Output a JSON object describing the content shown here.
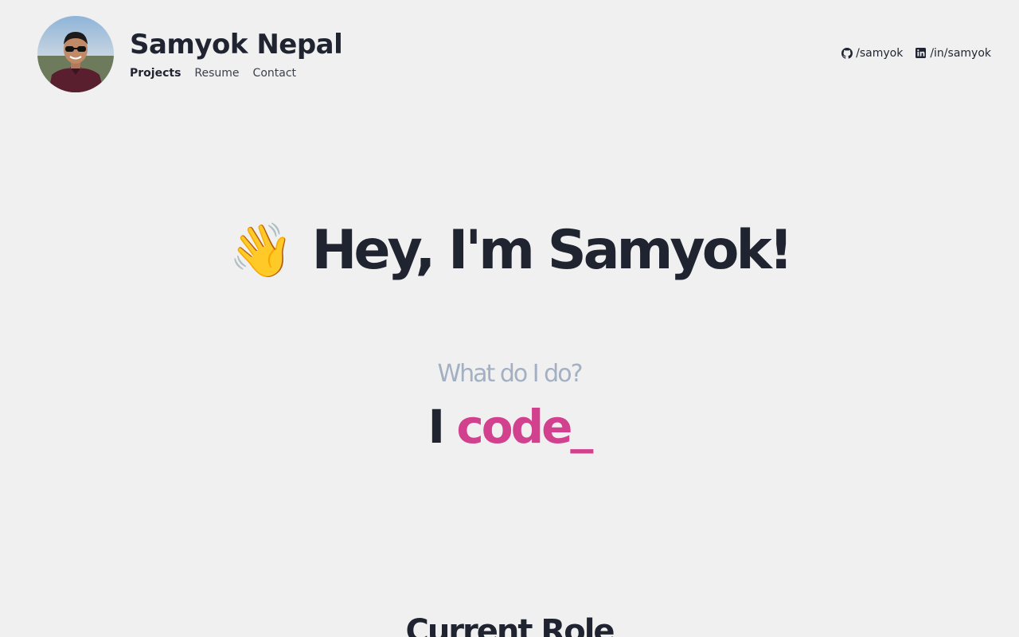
{
  "header": {
    "name": "Samyok Nepal",
    "nav": [
      {
        "label": "Projects",
        "active": true
      },
      {
        "label": "Resume",
        "active": false
      },
      {
        "label": "Contact",
        "active": false
      }
    ],
    "social": [
      {
        "icon": "github-icon",
        "label": "/samyok"
      },
      {
        "icon": "linkedin-icon",
        "label": "/in/samyok"
      }
    ]
  },
  "hero": {
    "emoji": "👋",
    "greeting": "Hey, I'm Samyok!",
    "question": "What do I do?",
    "statement_lead": "I",
    "statement_verb": "code_"
  },
  "sections": {
    "current_role_title": "Current Role"
  },
  "colors": {
    "background": "#f0f0f0",
    "text": "#1f2430",
    "muted": "#a3b0c2",
    "accent": "#d1418e"
  }
}
